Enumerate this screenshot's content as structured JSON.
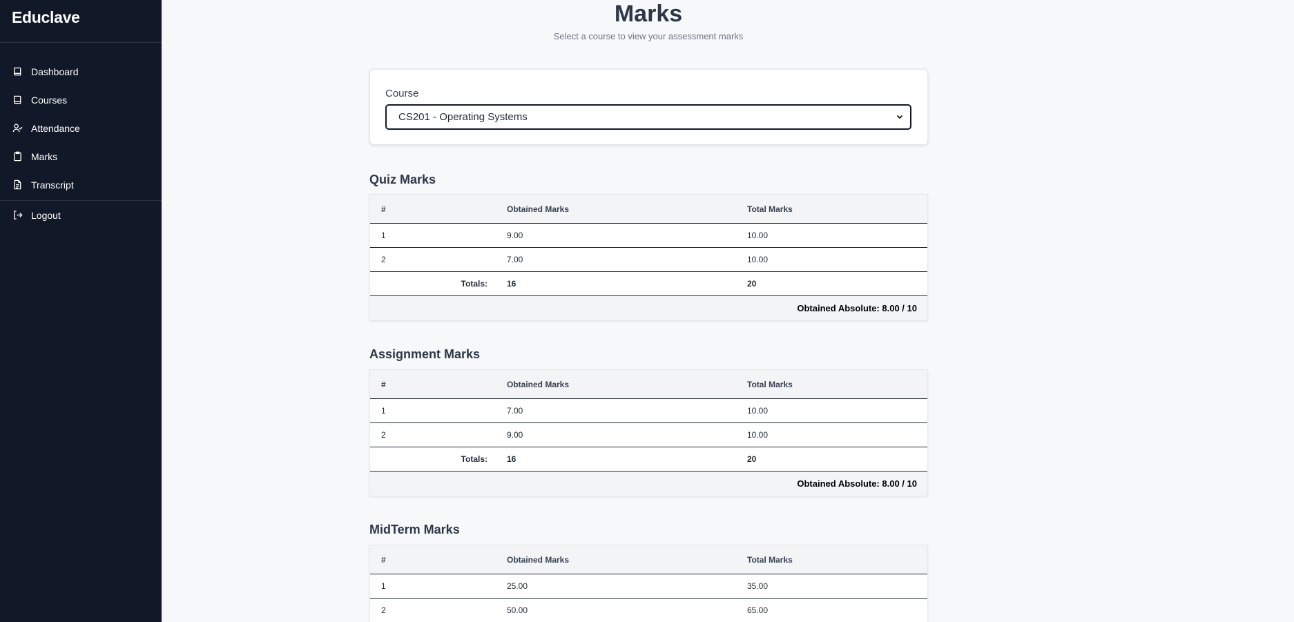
{
  "app": {
    "brand": "Educlave"
  },
  "sidebar": {
    "items": [
      {
        "label": "Dashboard",
        "icon": "book-icon"
      },
      {
        "label": "Courses",
        "icon": "book-icon"
      },
      {
        "label": "Attendance",
        "icon": "user-check-icon"
      },
      {
        "label": "Marks",
        "icon": "clipboard-icon"
      },
      {
        "label": "Transcript",
        "icon": "file-text-icon"
      }
    ],
    "logout": {
      "label": "Logout",
      "icon": "logout-icon"
    }
  },
  "page": {
    "title": "Marks",
    "subtitle": "Select a course to view your assessment marks"
  },
  "course": {
    "label": "Course",
    "selected": "CS201 - Operating Systems"
  },
  "sections": {
    "quiz": {
      "title": "Quiz Marks",
      "headers": [
        "#",
        "Obtained Marks",
        "Total Marks"
      ],
      "rows": [
        [
          "1",
          "9.00",
          "10.00"
        ],
        [
          "2",
          "7.00",
          "10.00"
        ]
      ],
      "totals_label": "Totals:",
      "totals": [
        "16",
        "20"
      ],
      "absolute": "Obtained Absolute: 8.00 / 10"
    },
    "assignment": {
      "title": "Assignment Marks",
      "headers": [
        "#",
        "Obtained Marks",
        "Total Marks"
      ],
      "rows": [
        [
          "1",
          "7.00",
          "10.00"
        ],
        [
          "2",
          "9.00",
          "10.00"
        ]
      ],
      "totals_label": "Totals:",
      "totals": [
        "16",
        "20"
      ],
      "absolute": "Obtained Absolute: 8.00 / 10"
    },
    "midterm": {
      "title": "MidTerm Marks",
      "headers": [
        "#",
        "Obtained Marks",
        "Total Marks"
      ],
      "rows": [
        [
          "1",
          "25.00",
          "35.00"
        ],
        [
          "2",
          "50.00",
          "65.00"
        ]
      ]
    }
  }
}
